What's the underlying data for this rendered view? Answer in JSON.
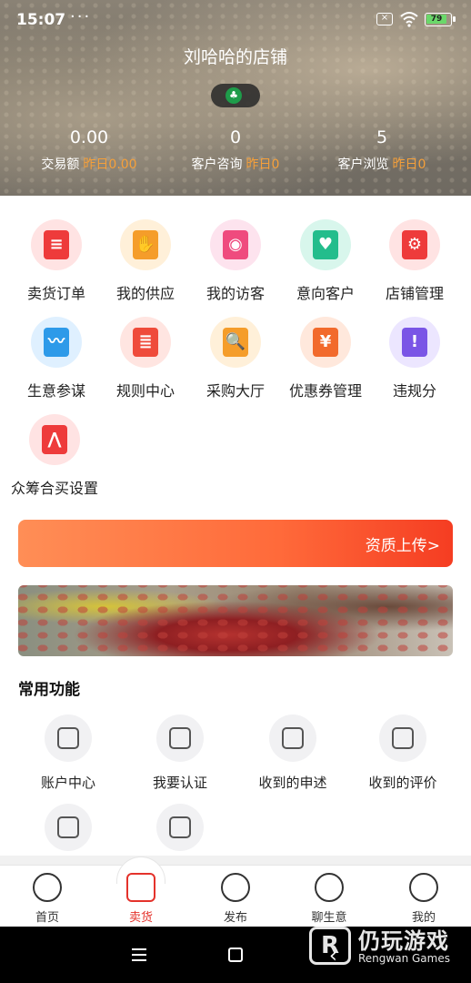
{
  "status_bar": {
    "time": "15:07",
    "dots": "···",
    "battery": "79"
  },
  "header": {
    "store_name": "刘哈哈的店铺",
    "stats": [
      {
        "value": "0.00",
        "label": "交易额",
        "yesterday": "昨日0.00"
      },
      {
        "value": "0",
        "label": "客户咨询",
        "yesterday": "昨日0"
      },
      {
        "value": "5",
        "label": "客户浏览",
        "yesterday": "昨日0"
      }
    ]
  },
  "grid": [
    {
      "label": "卖货订单",
      "icon": "order-icon",
      "bg": "#ffe3e3",
      "fg": "#ee3b3b"
    },
    {
      "label": "我的供应",
      "icon": "supply-hand-icon",
      "bg": "#fff0d9",
      "fg": "#f59d2a"
    },
    {
      "label": "我的访客",
      "icon": "visitor-eye-icon",
      "bg": "#fde3ee",
      "fg": "#ef4b7e"
    },
    {
      "label": "意向客户",
      "icon": "customer-heart-icon",
      "bg": "#d8f6ec",
      "fg": "#23bd8c"
    },
    {
      "label": "店铺管理",
      "icon": "store-settings-icon",
      "bg": "#ffe3e3",
      "fg": "#ee3b3b"
    },
    {
      "label": "生意参谋",
      "icon": "monitor-chart-icon",
      "bg": "#dff0ff",
      "fg": "#2d9ae9"
    },
    {
      "label": "规则中心",
      "icon": "rule-book-icon",
      "bg": "#ffe5e1",
      "fg": "#ef4b3b"
    },
    {
      "label": "采购大厅",
      "icon": "shopping-cart-icon",
      "bg": "#fff0d9",
      "fg": "#f59d2a"
    },
    {
      "label": "优惠券管理",
      "icon": "coupon-icon",
      "bg": "#ffe8dc",
      "fg": "#f26a2c"
    },
    {
      "label": "违规分",
      "icon": "warning-triangle-icon",
      "bg": "#ece6ff",
      "fg": "#7a55e6"
    },
    {
      "label": "众筹合买设置",
      "icon": "crowdfunding-logo-icon",
      "bg": "#ffe3e3",
      "fg": "#ee3b3b"
    }
  ],
  "upload_banner": {
    "label": "资质上传>"
  },
  "section_title": "常用功能",
  "functions": [
    {
      "label": "账户中心",
      "icon": "account-user-icon"
    },
    {
      "label": "我要认证",
      "icon": "certify-shield-icon"
    },
    {
      "label": "收到的申述",
      "icon": "appeal-document-icon"
    },
    {
      "label": "收到的评价",
      "icon": "review-chat-icon"
    },
    {
      "label": "",
      "icon": "bookmark-star-icon"
    },
    {
      "label": "",
      "icon": "yuan-shield-icon"
    }
  ],
  "tabs": [
    {
      "label": "首页",
      "icon": "home-icon",
      "active": false
    },
    {
      "label": "卖货",
      "icon": "sell-cart-icon",
      "active": true
    },
    {
      "label": "发布",
      "icon": "publish-up-icon",
      "active": false
    },
    {
      "label": "聊生意",
      "icon": "chat-icon",
      "active": false
    },
    {
      "label": "我的",
      "icon": "profile-smile-icon",
      "active": false
    }
  ],
  "watermark": {
    "title": "仍玩游戏",
    "sub": "Rengwan Games"
  },
  "colors": {
    "accent": "#e4322b",
    "orange": "#f6a03a"
  }
}
